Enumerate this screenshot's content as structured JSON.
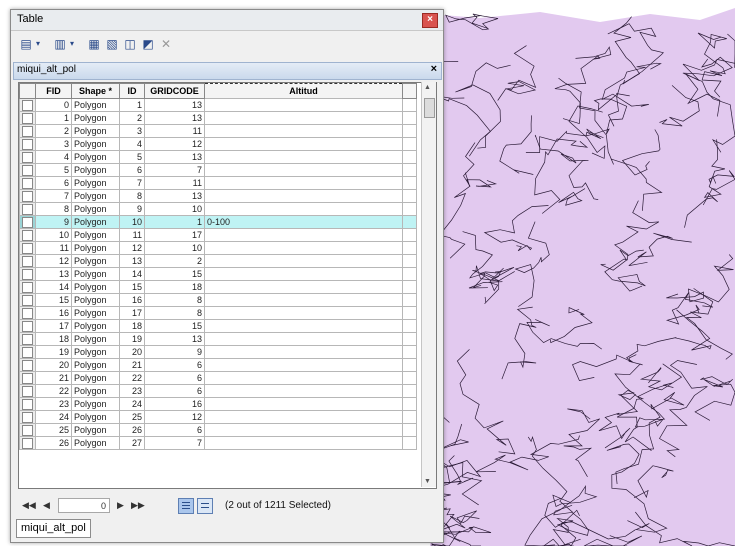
{
  "window": {
    "title": "Table",
    "close_glyph": "×"
  },
  "toolbar": {
    "icons": [
      "table-options-icon",
      "dropdown-arrow-icon",
      "related-tables-icon",
      "dropdown-arrow-icon",
      "select-by-attributes-icon",
      "switch-selection-icon",
      "clear-selection-icon",
      "zoom-to-selected-icon",
      "delete-selected-icon"
    ]
  },
  "table_tab": {
    "name": "miqui_alt_pol",
    "close": "×"
  },
  "columns": [
    "FID",
    "Shape *",
    "ID",
    "GRIDCODE",
    "Altitud"
  ],
  "rows": [
    [
      "0",
      "Polygon",
      "1",
      "13",
      ""
    ],
    [
      "1",
      "Polygon",
      "2",
      "13",
      ""
    ],
    [
      "2",
      "Polygon",
      "3",
      "11",
      ""
    ],
    [
      "3",
      "Polygon",
      "4",
      "12",
      ""
    ],
    [
      "4",
      "Polygon",
      "5",
      "13",
      ""
    ],
    [
      "5",
      "Polygon",
      "6",
      "7",
      ""
    ],
    [
      "6",
      "Polygon",
      "7",
      "11",
      ""
    ],
    [
      "7",
      "Polygon",
      "8",
      "13",
      ""
    ],
    [
      "8",
      "Polygon",
      "9",
      "10",
      ""
    ],
    [
      "9",
      "Polygon",
      "10",
      "1",
      "0-100"
    ],
    [
      "10",
      "Polygon",
      "11",
      "17",
      ""
    ],
    [
      "11",
      "Polygon",
      "12",
      "10",
      ""
    ],
    [
      "12",
      "Polygon",
      "13",
      "2",
      ""
    ],
    [
      "13",
      "Polygon",
      "14",
      "15",
      ""
    ],
    [
      "14",
      "Polygon",
      "15",
      "18",
      ""
    ],
    [
      "15",
      "Polygon",
      "16",
      "8",
      ""
    ],
    [
      "16",
      "Polygon",
      "17",
      "8",
      ""
    ],
    [
      "17",
      "Polygon",
      "18",
      "15",
      ""
    ],
    [
      "18",
      "Polygon",
      "19",
      "13",
      ""
    ],
    [
      "19",
      "Polygon",
      "20",
      "9",
      ""
    ],
    [
      "20",
      "Polygon",
      "21",
      "6",
      ""
    ],
    [
      "21",
      "Polygon",
      "22",
      "6",
      ""
    ],
    [
      "22",
      "Polygon",
      "23",
      "6",
      ""
    ],
    [
      "23",
      "Polygon",
      "24",
      "16",
      ""
    ],
    [
      "24",
      "Polygon",
      "25",
      "12",
      ""
    ],
    [
      "25",
      "Polygon",
      "26",
      "6",
      ""
    ],
    [
      "26",
      "Polygon",
      "27",
      "7",
      ""
    ]
  ],
  "selected_row_fid": "9",
  "navigation": {
    "first": "◀◀",
    "prev": "◀",
    "current": "0",
    "next": "▶",
    "last": "▶▶"
  },
  "status": "(2 out of 1211 Selected)",
  "bottom_tab": "miqui_alt_pol",
  "colors": {
    "map_fill": "#e2c9ef",
    "contour": "#2a1a36",
    "selected_row": "#bff3f4"
  }
}
